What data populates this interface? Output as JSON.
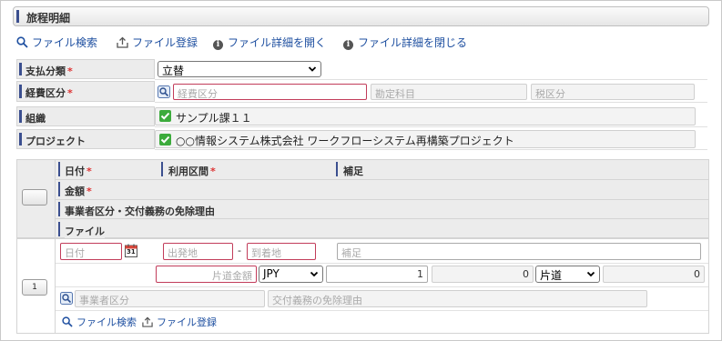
{
  "section": {
    "title": "旅程明細"
  },
  "toolbar": [
    {
      "label": "ファイル検索",
      "icon": "search-icon"
    },
    {
      "label": "ファイル登録",
      "icon": "upload-icon"
    },
    {
      "label": "ファイル詳細を開く",
      "icon": "info-icon"
    },
    {
      "label": "ファイル詳細を閉じる",
      "icon": "info-icon"
    }
  ],
  "form": {
    "payment": {
      "label": "支払分類",
      "required": "*",
      "value": "立替"
    },
    "expense": {
      "label": "経費区分",
      "required": "*",
      "placeholder": "経費区分",
      "account_placeholder": "勘定科目",
      "tax_placeholder": "税区分"
    },
    "organization": {
      "label": "組織",
      "value": "サンプル課１１"
    },
    "project": {
      "label": "プロジェクト",
      "value": "○○情報システム株式会社 ワークフローシステム再構築プロジェクト"
    }
  },
  "detail_header": {
    "date": "日付",
    "route": "利用区間",
    "note": "補足",
    "amount": "金額",
    "business": "事業者区分・交付義務の免除理由",
    "file": "ファイル",
    "required": "*"
  },
  "detail_row": {
    "row_number": "1",
    "date_placeholder": "日付",
    "calendar_day": "31",
    "from_placeholder": "出発地",
    "dash": "-",
    "to_placeholder": "到着地",
    "note_placeholder": "補足",
    "amount_placeholder": "片道金額",
    "currency": "JPY",
    "rate": "1",
    "converted": "0",
    "trip_type": "片道",
    "total": "0",
    "business_placeholder": "事業者区分",
    "exemption_placeholder": "交付義務の免除理由",
    "file_search": "ファイル検索",
    "file_register": "ファイル登録"
  },
  "colors": {
    "accent": "#3b4f8f",
    "link": "#1e4fa0",
    "required": "#d33",
    "check": "#3cab3c",
    "required_border": "#c23c5a"
  }
}
